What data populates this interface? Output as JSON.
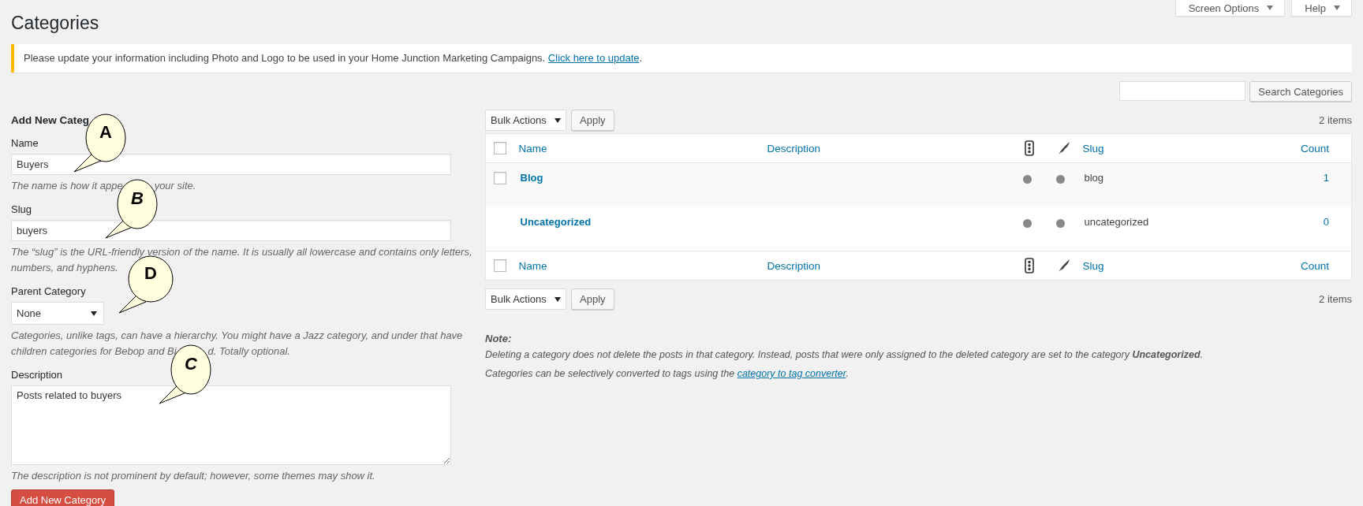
{
  "header_tabs": [
    {
      "label": "Screen Options"
    },
    {
      "label": "Help"
    }
  ],
  "page_title": "Categories",
  "notice": {
    "text": "Please update your information including Photo and Logo to be used in your Home Junction Marketing Campaigns.",
    "link": "Click here to update",
    "after": "."
  },
  "search": {
    "button": "Search Categories"
  },
  "form": {
    "heading": "Add New Categ",
    "heading_callout": "A",
    "fields": [
      {
        "kind": "text",
        "label": "Name",
        "value": "Buyers",
        "hint": [
          "The name is how it appe",
          "your site."
        ],
        "hint_callout": "B"
      },
      {
        "kind": "text",
        "label": "Slug",
        "value": "buyers",
        "hint": [
          "The “slug” is the URL-friendly version of the name. It is usually all lowercase and contains only letters,",
          "numbers, and hyphens."
        ]
      },
      {
        "kind": "select",
        "label": "Parent Category",
        "value": "None",
        "callout": "D",
        "hint": [
          "Categories, unlike tags, can have a hierarchy. You might have a Jazz category, and under that have",
          "children categories for Bebop and Bi",
          "d. Totally optional."
        ],
        "hint_callout": "C"
      },
      {
        "kind": "textarea",
        "label": "Description",
        "value": "Posts related to buyers",
        "hint": [
          "The description is not prominent by default; however, some themes may show it."
        ]
      }
    ],
    "submit": "Add New Category"
  },
  "top_nav": {
    "bulk": "Bulk Actions",
    "apply": "Apply",
    "count": "2 items"
  },
  "table": {
    "header_columns": [
      {
        "kind": "checkbox",
        "checked": false
      },
      {
        "kind": "label",
        "label": "Name"
      },
      {
        "kind": "label",
        "label": "Description"
      },
      {
        "kind": "icon"
      },
      {
        "kind": "icon"
      },
      {
        "kind": "label",
        "label": "Slug"
      },
      {
        "kind": "label",
        "label": "Count"
      }
    ],
    "rows": [
      {
        "name": "Blog",
        "selectable": true,
        "checked": false,
        "slug": "blog",
        "count": "1"
      },
      {
        "name": "Uncategorized",
        "selectable": false,
        "slug": "uncategorized",
        "count": "0"
      }
    ],
    "footer_columns": [
      {
        "kind": "checkbox",
        "checked": false
      },
      {
        "kind": "label",
        "label": "Name"
      },
      {
        "kind": "label",
        "label": "Description"
      },
      {
        "kind": "icon"
      },
      {
        "kind": "icon"
      },
      {
        "kind": "label",
        "label": "Slug"
      },
      {
        "kind": "label",
        "label": "Count"
      }
    ]
  },
  "bottom_nav": {
    "bulk": "Bulk Actions",
    "apply": "Apply",
    "count": "2 items"
  },
  "note": {
    "title": "Note:",
    "text": "Deleting a category does not delete the posts in that category. Instead, posts that were only assigned to the deleted category are set to the category **Uncategorized**.",
    "converter_before": "Categories can be selectively converted to tags using the",
    "converter_link": "category to tag converter",
    "converter_after": "."
  }
}
